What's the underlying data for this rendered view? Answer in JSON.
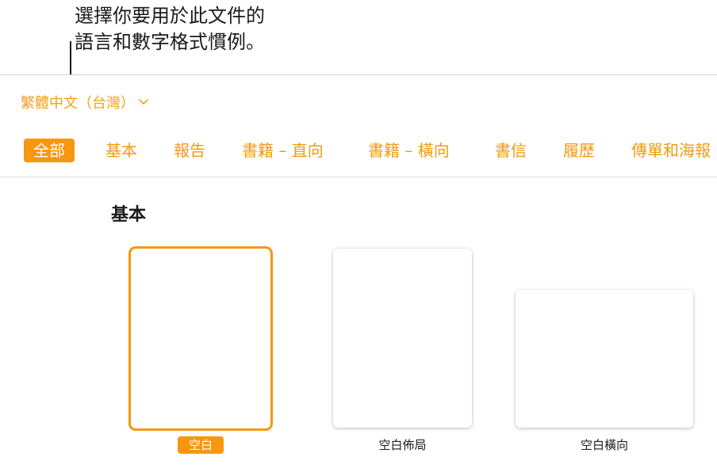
{
  "callout": {
    "line1": "選擇你要用於此文件的",
    "line2": "語言和數字格式慣例。"
  },
  "language": {
    "selected": "繁體中文（台灣）",
    "icon": "chevron-down-icon"
  },
  "tabs": [
    {
      "label": "全部",
      "active": true
    },
    {
      "label": "基本",
      "active": false
    },
    {
      "label": "報告",
      "active": false
    },
    {
      "label": "書籍 – 直向",
      "active": false
    },
    {
      "label": "書籍 – 橫向",
      "active": false
    },
    {
      "label": "書信",
      "active": false
    },
    {
      "label": "履歷",
      "active": false
    },
    {
      "label": "傳單和海報",
      "active": false
    }
  ],
  "section": {
    "title": "基本"
  },
  "templates": [
    {
      "label": "空白",
      "selected": true
    },
    {
      "label": "空白佈局",
      "selected": false
    },
    {
      "label": "空白橫向",
      "selected": false
    }
  ],
  "colors": {
    "accent": "#f7970f",
    "text": "#1a1a1a"
  }
}
